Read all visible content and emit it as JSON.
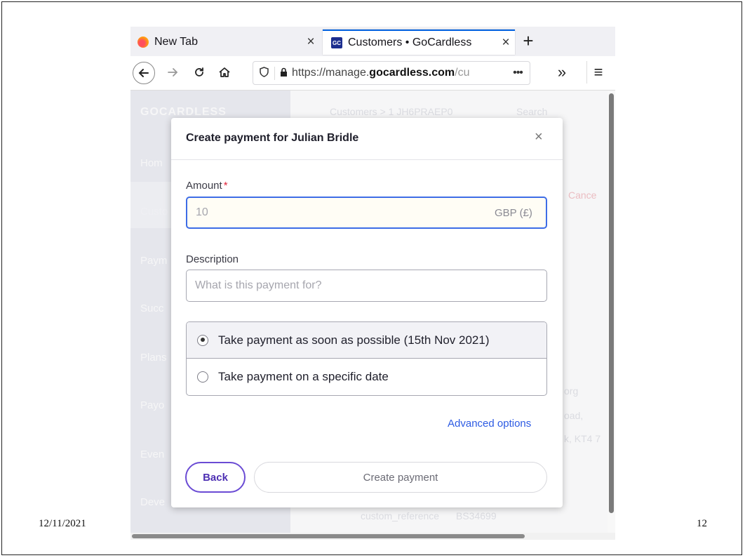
{
  "slide": {
    "date": "12/11/2021",
    "page_number": "12"
  },
  "browser": {
    "tabs": [
      {
        "title": "New Tab",
        "icon": "firefox-icon"
      },
      {
        "title": "Customers • GoCardless",
        "icon": "gocardless-favicon"
      }
    ],
    "tab_close_glyph": "×",
    "new_tab_glyph": "+",
    "url_prefix": "https://manage.",
    "url_domain": "gocardless.com",
    "url_suffix": "/cu",
    "url_more": "•••",
    "overflow_glyph": "»",
    "menu_glyph": "≡"
  },
  "background": {
    "brand": "GOCARDLESS",
    "nav_items": [
      "Hom",
      "Custo",
      "Paym",
      "Succ",
      "Plans",
      "Payo",
      "Even",
      "Deve"
    ],
    "breadcrumb": "Customers > 1 JH6PRAEP0",
    "search": "Search",
    "cancel": "Cance",
    "details": [
      "org",
      "oad,",
      "k, KT4 7"
    ],
    "custom_reference_label": "custom_reference",
    "custom_reference_value": "BS34699"
  },
  "modal": {
    "title": "Create payment for Julian Bridle",
    "close_glyph": "×",
    "amount_label": "Amount",
    "required_mark": "*",
    "amount_placeholder": "10",
    "amount_suffix": "GBP (£)",
    "description_label": "Description",
    "description_placeholder": "What is this payment for?",
    "options": [
      {
        "label": "Take payment as soon as possible (15th Nov 2021)",
        "selected": true
      },
      {
        "label": "Take payment on a specific date",
        "selected": false
      }
    ],
    "advanced_link": "Advanced options",
    "back_button": "Back",
    "create_button": "Create payment"
  }
}
